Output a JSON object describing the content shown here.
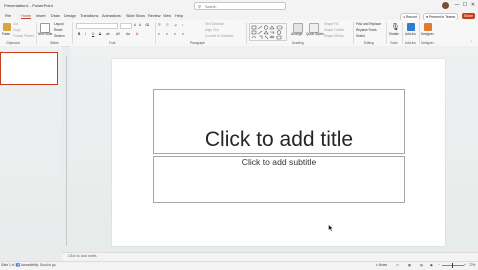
{
  "window": {
    "title": "Presentation1 - PowerPoint",
    "search_placeholder": "Search",
    "controls": [
      "—",
      "☐",
      "✕"
    ]
  },
  "tabs": [
    "File",
    "Home",
    "Insert",
    "Draw",
    "Design",
    "Transitions",
    "Animations",
    "Slide Show",
    "Review",
    "View",
    "Help"
  ],
  "active_tab": "Home",
  "right_actions": {
    "record": "Record",
    "present": "Present in Teams",
    "share": "Share"
  },
  "ribbon": {
    "clipboard": {
      "label": "Clipboard",
      "paste": "Paste",
      "cut": "Cut",
      "copy": "Copy",
      "format_painter": "Format Painter"
    },
    "slides": {
      "label": "Slides",
      "new_slide": "New Slide",
      "layout": "Layout",
      "reset": "Reset",
      "section": "Section"
    },
    "font": {
      "label": "Font",
      "buttons": [
        "B",
        "I",
        "U",
        "S",
        "ab",
        "AV",
        "Aa",
        "A"
      ]
    },
    "paragraph": {
      "label": "Paragraph",
      "text_direction": "Text Direction",
      "align_text": "Align Text",
      "smartart": "Convert to SmartArt"
    },
    "drawing": {
      "label": "Drawing",
      "arrange": "Arrange",
      "quick_styles": "Quick Styles",
      "shape_fill": "Shape Fill",
      "shape_outline": "Shape Outline",
      "shape_effects": "Shape Effects"
    },
    "editing": {
      "label": "Editing",
      "find": "Find and Replace",
      "replace": "Replace Fonts",
      "select": "Select"
    },
    "voice": {
      "label": "Voice",
      "dictate": "Dictate"
    },
    "addins": {
      "label": "Add-ins",
      "addins": "Add-ins"
    },
    "designer": {
      "label": "Designer",
      "designer": "Designer"
    }
  },
  "slides_pane": {
    "slide_number": "1"
  },
  "slide": {
    "title_placeholder": "Click to add title",
    "subtitle_placeholder": "Click to add subtitle"
  },
  "notes": {
    "placeholder": "Click to add notes"
  },
  "status": {
    "slide_of": "Slide 1 of 1",
    "accessibility": "Accessibility: Good to go",
    "notes_btn": "Notes",
    "zoom": "72%"
  },
  "colors": {
    "accent": "#c43e1c",
    "tab_active": "#b7472a"
  }
}
